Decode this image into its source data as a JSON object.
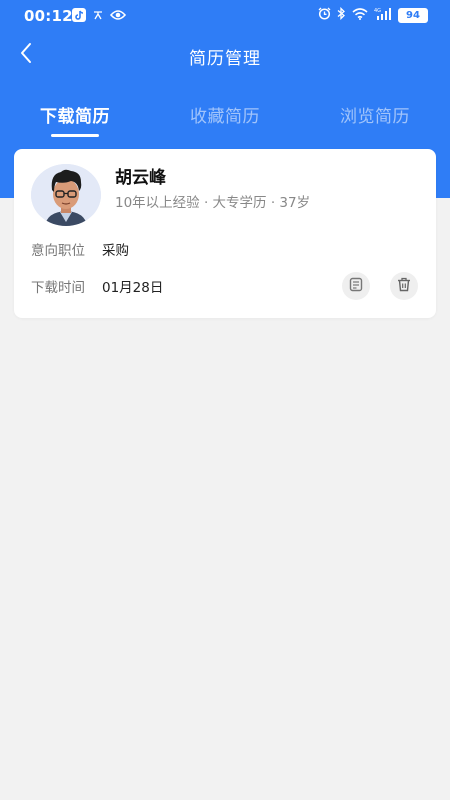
{
  "status_bar": {
    "time": "00:12",
    "left_icons": [
      "tiktok-icon",
      "chinese-input-icon",
      "eye-icon"
    ],
    "right_icons": [
      "alarm-icon",
      "bluetooth-icon",
      "wifi-icon",
      "signal-4g-icon"
    ],
    "battery": "94"
  },
  "nav": {
    "title": "简历管理",
    "back_icon": "chevron-left-icon"
  },
  "tabs": [
    {
      "label": "下载简历",
      "active": true
    },
    {
      "label": "收藏简历",
      "active": false
    },
    {
      "label": "浏览简历",
      "active": false
    }
  ],
  "resume_card": {
    "name": "胡云峰",
    "meta": "10年以上经验 · 大专学历 · 37岁",
    "intent_label": "意向职位",
    "intent_value": "采购",
    "download_time_label": "下载时间",
    "download_time_value": "01月28日",
    "actions": [
      "note-icon",
      "trash-icon"
    ]
  },
  "colors": {
    "primary": "#2f7df6",
    "background": "#f2f2f2",
    "card": "#ffffff"
  }
}
